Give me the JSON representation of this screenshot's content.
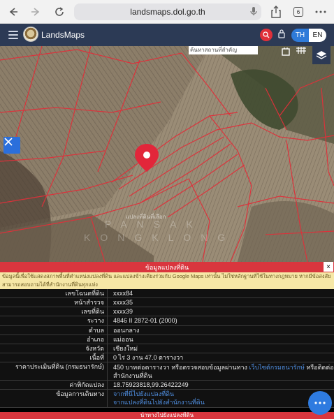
{
  "browser": {
    "url": "landsmaps.dol.go.th",
    "tab_count": "6"
  },
  "header": {
    "app_title": "LandsMaps",
    "lang_th": "TH",
    "lang_en": "EN"
  },
  "map": {
    "search_placeholder": "ค้นหาสถานที่สำคัญ",
    "pin_label": "แปลงที่ดินที่เลือก",
    "watermark_line1": "PANSAK",
    "watermark_line2": "KONGKLONG"
  },
  "panel": {
    "title": "ข้อมูลแปลงที่ดิน",
    "close": "×",
    "notice": "ข้อมูลนี้เพื่อใช้แสดงสภาพพื้นที่ตำแหน่งแปลงที่ดิน และแปลงข้างเคียงร่วมกับ Google Maps เท่านั้น ไม่ใช่หลักฐานที่ใช้ในทางกฎหมาย หากมีข้อสงสัยสามารถสอบถามได้ที่สำนักงานที่ดินทุกแห่ง",
    "rows": [
      {
        "key": "เลขโฉนดที่ดิน",
        "value": "xxxx84"
      },
      {
        "key": "หน้าสำรวจ",
        "value": "xxxx35"
      },
      {
        "key": "เลขที่ดิน",
        "value": "xxxx39"
      },
      {
        "key": "ระวาง",
        "value": "4846 II 2872-01 (2000)"
      },
      {
        "key": "ตำบล",
        "value": "ออนกลาง"
      },
      {
        "key": "อำเภอ",
        "value": "แม่ออน"
      },
      {
        "key": "จังหวัด",
        "value": "เชียงใหม่"
      },
      {
        "key": "เนื้อที่",
        "value": "0 ไร่ 3 งาน 47.0 ตารางวา"
      }
    ],
    "price_key": "ราคาประเมินที่ดิน (กรมธนารักษ์)",
    "price_value": "450 บาทต่อตารางวา หรือตรวจสอบข้อมูลผ่านทาง",
    "price_link": "เว็บไซต์กรมธนารักษ์",
    "price_tail": "หรือติดต่อสำนักงานที่ดิน",
    "coord_key": "ค่าพิกัดแปลง",
    "coord_value": "18.75923818,99.26422249",
    "route_key": "ข้อมูลการเดินทาง",
    "route_link1": "จากที่นี่ไปยังแปลงที่ดิน",
    "route_link2": "จากแปลงที่ดินไปยังสำนักงานที่ดิน",
    "footer": "นำทางไปยังแปลงที่ดิน"
  },
  "colors": {
    "header_bg": "#2c3a55",
    "accent_red": "#d9363e",
    "accent_blue": "#2e7be0",
    "parcel_line": "#e0303a"
  }
}
